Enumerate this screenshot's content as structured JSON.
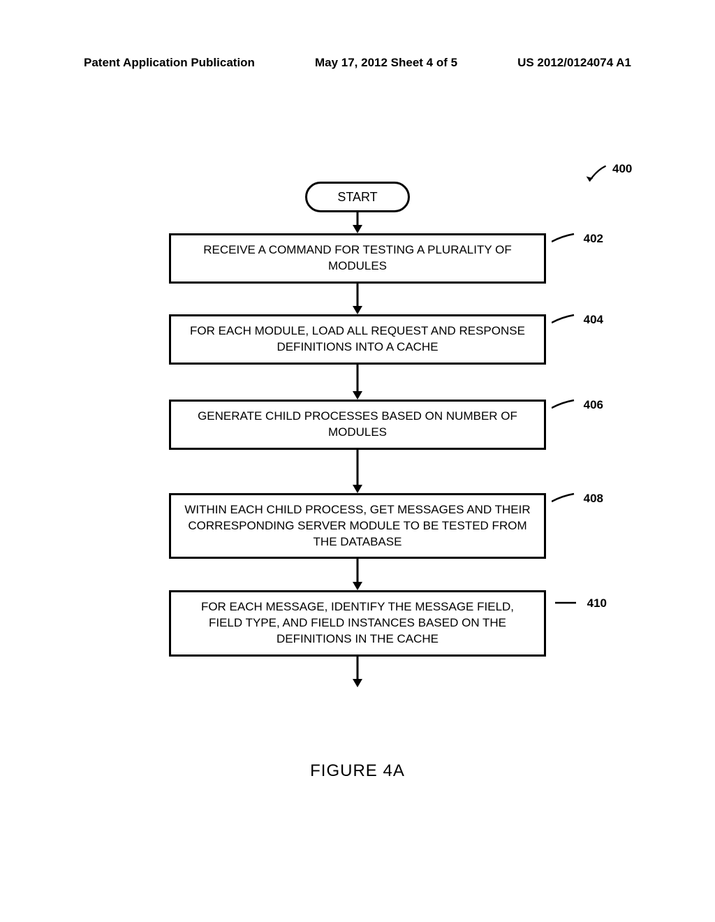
{
  "header": {
    "left": "Patent Application Publication",
    "center": "May 17, 2012  Sheet 4 of 5",
    "right": "US 2012/0124074 A1"
  },
  "flowchart": {
    "ref_400": "400",
    "start": "START",
    "steps": [
      {
        "text": "RECEIVE A COMMAND FOR TESTING A PLURALITY OF MODULES",
        "ref": "402"
      },
      {
        "text": "FOR EACH MODULE, LOAD ALL REQUEST AND RESPONSE DEFINITIONS INTO A CACHE",
        "ref": "404"
      },
      {
        "text": "GENERATE CHILD PROCESSES BASED ON NUMBER OF MODULES",
        "ref": "406"
      },
      {
        "text": "WITHIN EACH CHILD PROCESS, GET MESSAGES AND THEIR CORRESPONDING SERVER MODULE TO BE TESTED FROM THE DATABASE",
        "ref": "408"
      },
      {
        "text": "FOR EACH MESSAGE, IDENTIFY THE MESSAGE FIELD, FIELD TYPE, AND FIELD INSTANCES BASED ON THE DEFINITIONS IN THE CACHE",
        "ref": "410"
      }
    ]
  },
  "figure_label": "FIGURE 4A",
  "chart_data": {
    "type": "flowchart",
    "title": "FIGURE 4A",
    "reference_number": "400",
    "nodes": [
      {
        "id": "start",
        "type": "terminator",
        "label": "START"
      },
      {
        "id": "402",
        "type": "process",
        "label": "RECEIVE A COMMAND FOR TESTING A PLURALITY OF MODULES"
      },
      {
        "id": "404",
        "type": "process",
        "label": "FOR EACH MODULE, LOAD ALL REQUEST AND RESPONSE DEFINITIONS INTO A CACHE"
      },
      {
        "id": "406",
        "type": "process",
        "label": "GENERATE CHILD PROCESSES BASED ON NUMBER OF MODULES"
      },
      {
        "id": "408",
        "type": "process",
        "label": "WITHIN EACH CHILD PROCESS, GET MESSAGES AND THEIR CORRESPONDING SERVER MODULE TO BE TESTED FROM THE DATABASE"
      },
      {
        "id": "410",
        "type": "process",
        "label": "FOR EACH MESSAGE, IDENTIFY THE MESSAGE FIELD, FIELD TYPE, AND FIELD INSTANCES BASED ON THE DEFINITIONS IN THE CACHE"
      }
    ],
    "edges": [
      {
        "from": "start",
        "to": "402"
      },
      {
        "from": "402",
        "to": "404"
      },
      {
        "from": "404",
        "to": "406"
      },
      {
        "from": "406",
        "to": "408"
      },
      {
        "from": "408",
        "to": "410"
      },
      {
        "from": "410",
        "to": "continue"
      }
    ]
  }
}
